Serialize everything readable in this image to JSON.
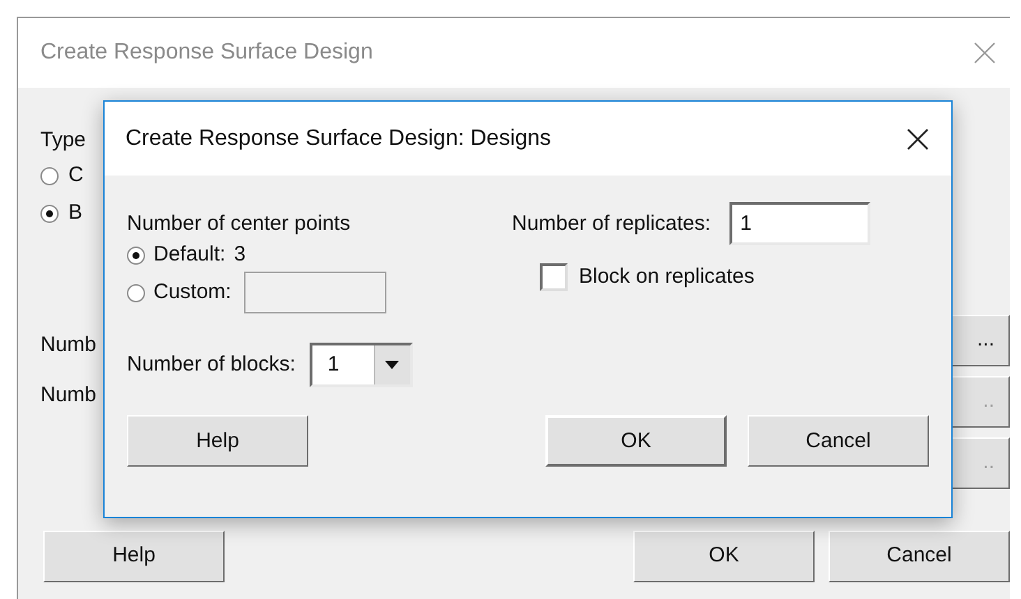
{
  "background_window": {
    "title": "Create Response Surface Design",
    "type_label": "Type",
    "type_options": [
      {
        "label": "C",
        "selected": false
      },
      {
        "label": "B",
        "selected": true
      }
    ],
    "labels": [
      "Numb",
      "Numb"
    ],
    "side_buttons": [
      {
        "label": "...",
        "disabled": false
      },
      {
        "label": "..",
        "disabled": true
      },
      {
        "label": "..",
        "disabled": true
      }
    ],
    "buttons": [
      "Help",
      "OK",
      "Cancel"
    ]
  },
  "dialog": {
    "title": "Create Response Surface Design: Designs",
    "center_points_label": "Number of center points",
    "center_options": [
      {
        "kind": "value",
        "label": "Default:",
        "value": "3",
        "selected": true
      },
      {
        "kind": "field",
        "label": "Custom:",
        "selected": false
      }
    ],
    "blocks_label": "Number of blocks:",
    "blocks_value": "1",
    "replicates_label": "Number of replicates:",
    "replicates_value": "1",
    "block_on_replicates": {
      "label": "Block on replicates",
      "checked": false
    },
    "buttons": [
      "Help",
      "OK",
      "Cancel"
    ]
  }
}
